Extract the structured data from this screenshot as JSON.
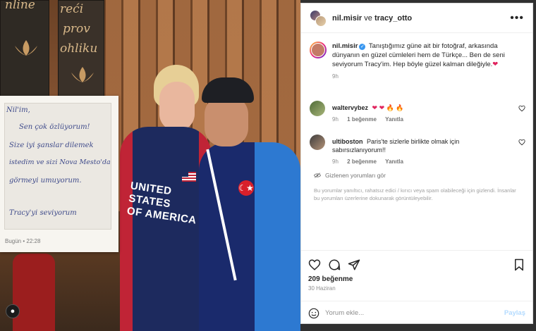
{
  "header": {
    "user1": "nil.misir",
    "joiner": "ve",
    "user2": "tracy_otto",
    "more_icon": "more-horizontal-icon"
  },
  "caption": {
    "username": "nil.misir",
    "text": "Tanıştığımız güne ait bir fotoğraf, arkasında dünyanın en güzel cümleleri hem de Türkçe... Ben de seni seviyorum Tracy'im. Hep böyle güzel kalman dileğiyle.",
    "heart": "❤",
    "time": "9h"
  },
  "comments": [
    {
      "username": "waltervybez",
      "text": "❤ ❤ 🔥 🔥",
      "time": "9h",
      "likes": "1 beğenme",
      "reply": "Yanıtla"
    },
    {
      "username": "ultiboston",
      "text": "Paris'te sizlerle birlikte olmak için sabırsızlanıyorum!!",
      "time": "9h",
      "likes": "2 beğenme",
      "reply": "Yanıtla"
    }
  ],
  "hidden": {
    "label": "Gizlenen yorumları gör",
    "note": "Bu yorumlar yanıltıcı, rahatsız edici / kırıcı veya spam olabileceği için gizlendi. İnsanlar bu yorumları üzerlerine dokunarak görüntüleyebilir."
  },
  "post": {
    "likes": "209 beğenme",
    "date": "30 Haziran"
  },
  "comment_box": {
    "placeholder": "Yorum ekle...",
    "post_label": "Paylaş"
  },
  "photo": {
    "banner_a": [
      "nline",
      "n"
    ],
    "banner_b": [
      "reći",
      "prov",
      "ohliku"
    ],
    "shirt_text": [
      "UNITED STATES",
      "OF AMERICA"
    ],
    "tr_symbol": "☾★",
    "note_lines": [
      "Nil'im,",
      "Sen çok özlüyorum!",
      "Size iyi şanslar dilemek",
      "istedim ve sizi Nova Mesto'da",
      "görmeyi umuyorum.",
      "Tracy'yi seviyorum"
    ],
    "note_time": "Bugün • 22:28"
  },
  "colors": {
    "accent": "#0095f6",
    "heart": "#e0245e",
    "muted": "#8e8e8e"
  }
}
